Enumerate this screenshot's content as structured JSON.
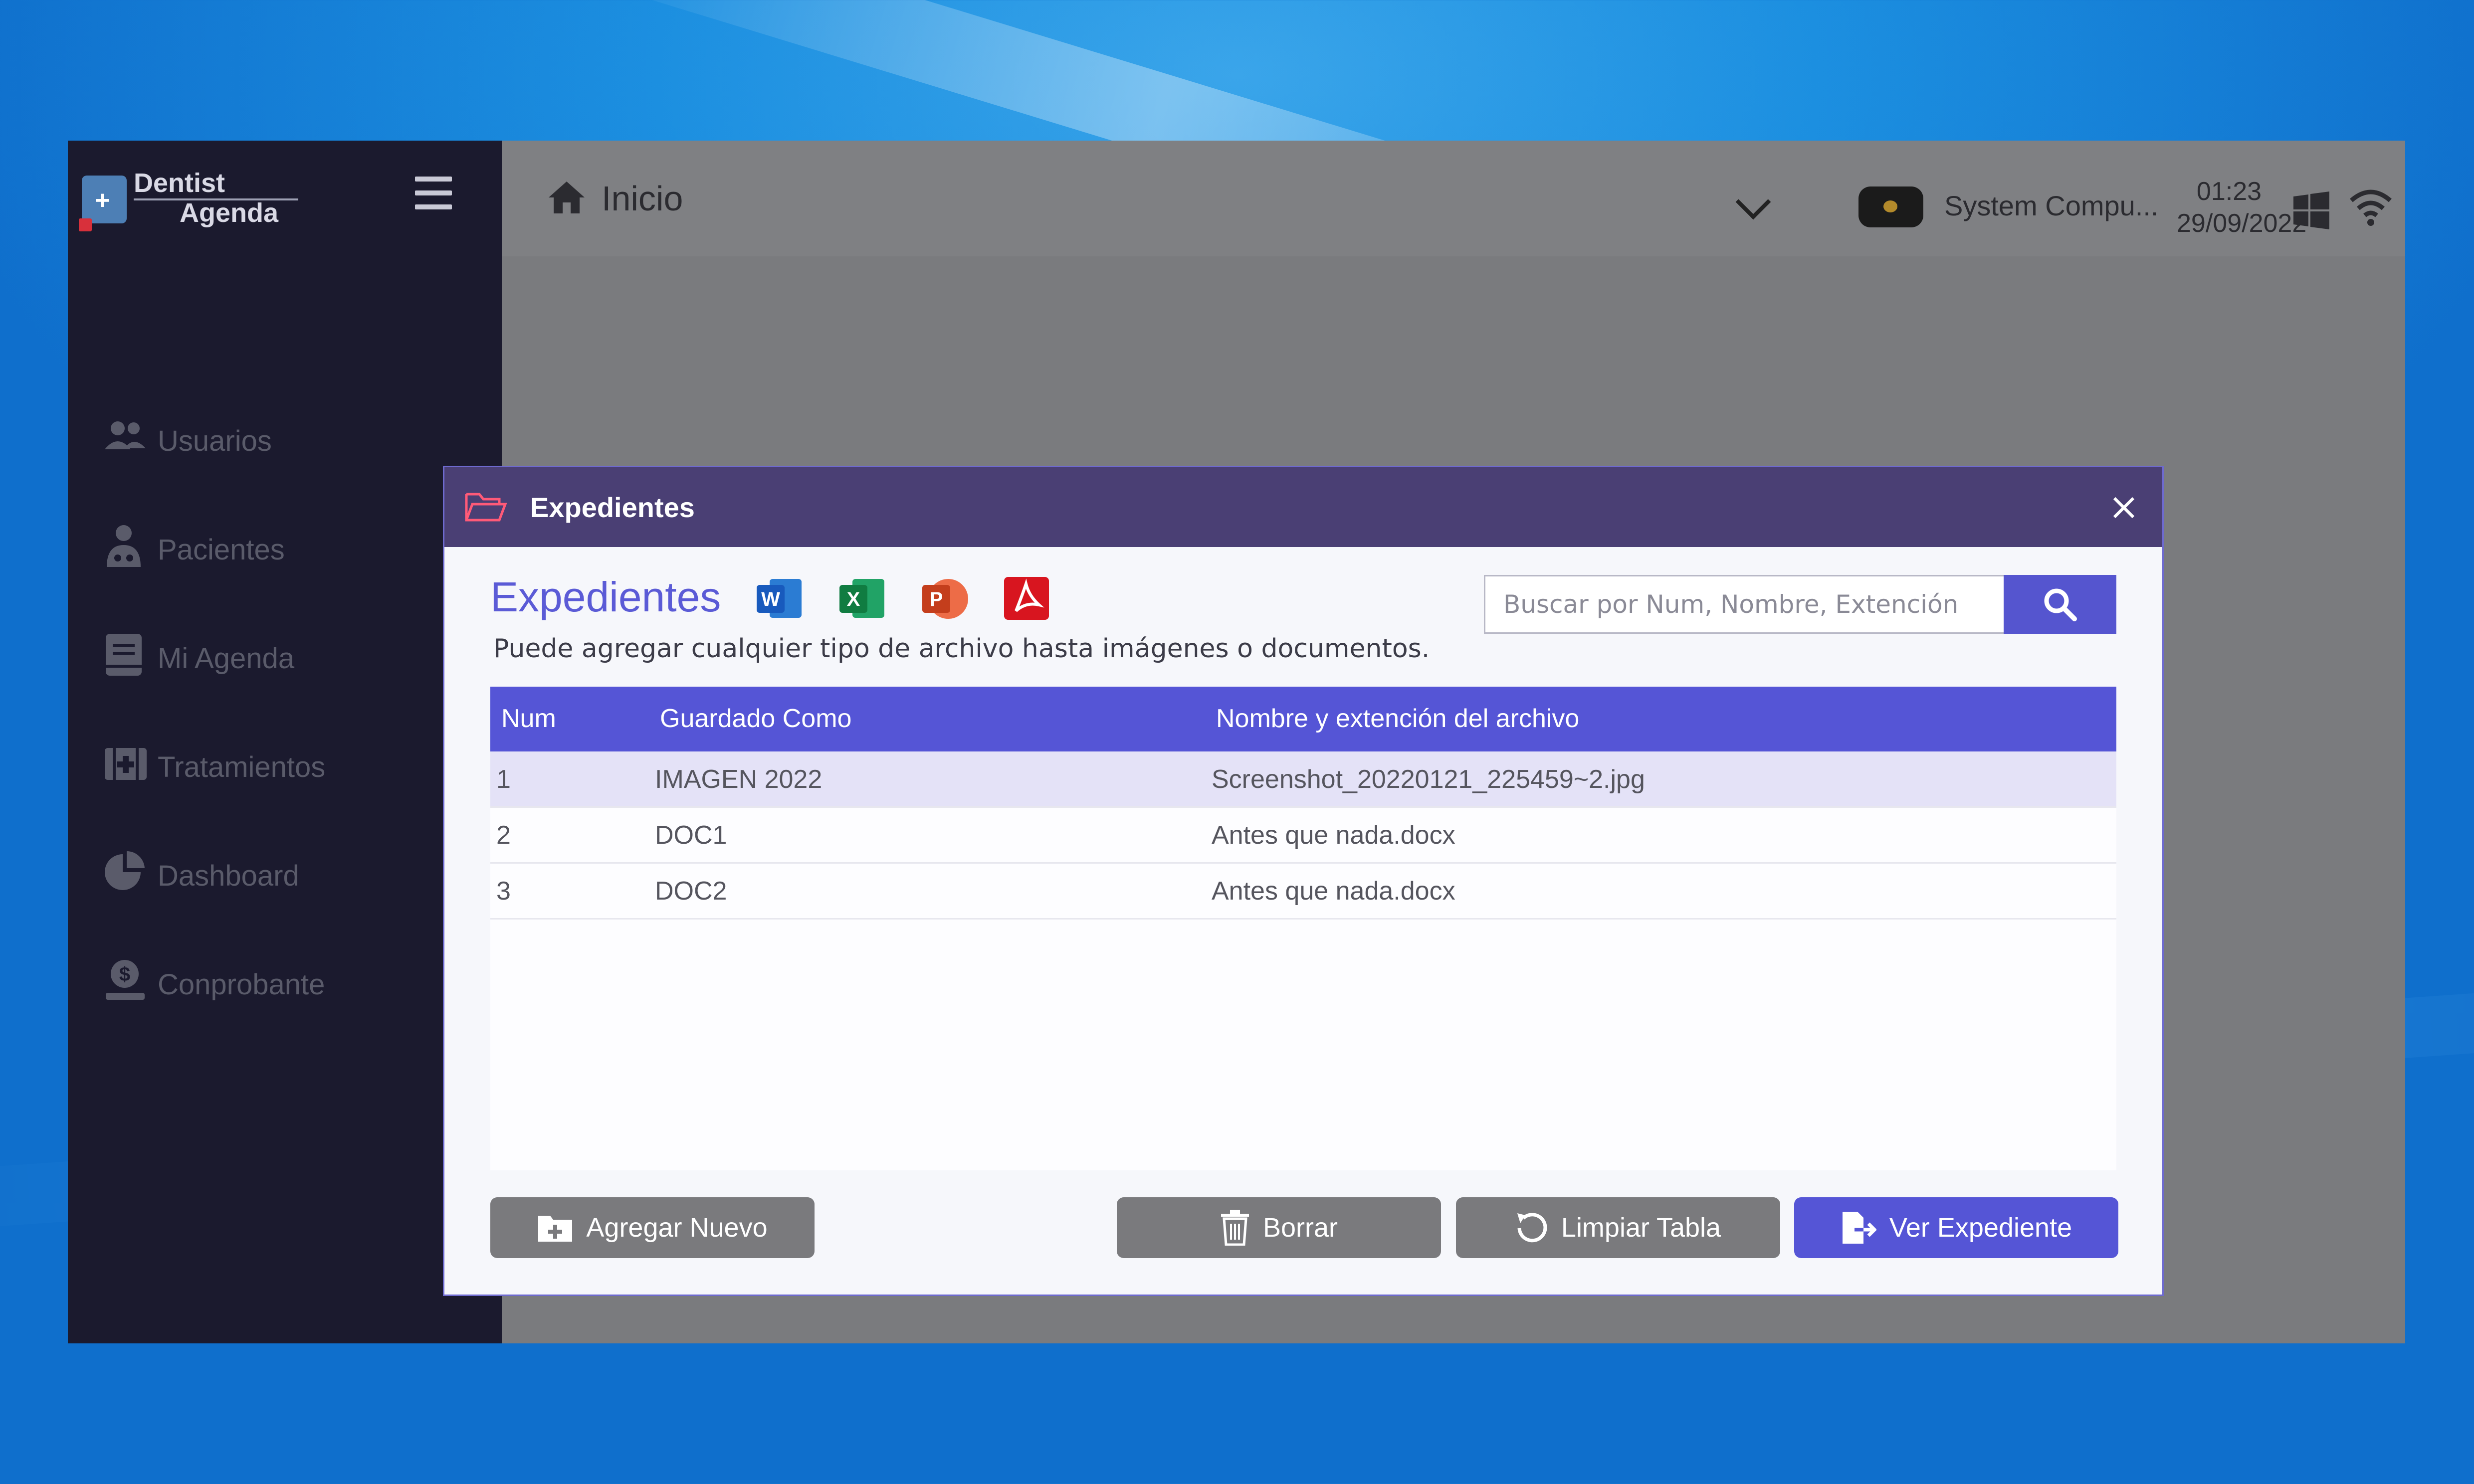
{
  "app": {
    "logo": {
      "line1": "Dentist",
      "line2": "Agenda"
    },
    "topbar": {
      "title": "Inicio",
      "system_label": "System Compu...",
      "time": "01:23",
      "date": "29/09/2022"
    },
    "sidebar": {
      "items": [
        {
          "label": "Usuarios",
          "icon": "users-icon"
        },
        {
          "label": "Pacientes",
          "icon": "doctor-icon"
        },
        {
          "label": "Mi Agenda",
          "icon": "agenda-icon"
        },
        {
          "label": "Tratamientos",
          "icon": "medical-kit-icon"
        },
        {
          "label": "Dashboard",
          "icon": "pie-chart-icon"
        },
        {
          "label": "Conprobante",
          "icon": "money-icon"
        }
      ]
    }
  },
  "dialog": {
    "header_title": "Expedientes",
    "title": "Expedientes",
    "file_types": [
      {
        "label": "W",
        "color": "#2b5fb4"
      },
      {
        "label": "X",
        "color": "#1f7b43"
      },
      {
        "label": "P",
        "color": "#d24a25"
      },
      {
        "label": "",
        "color": "#c8161d"
      }
    ],
    "subtitle": "Puede agregar cualquier tipo de archivo hasta imágenes o documentos.",
    "search_placeholder": "Buscar por Num, Nombre, Extención",
    "table": {
      "columns": [
        "Num",
        "Guardado Como",
        "Nombre y extención del archivo"
      ],
      "rows": [
        {
          "num": "1",
          "saved_as": "IMAGEN 2022",
          "filename": "Screenshot_20220121_225459~2.jpg"
        },
        {
          "num": "2",
          "saved_as": "DOC1",
          "filename": "Antes que nada.docx"
        },
        {
          "num": "3",
          "saved_as": "DOC2",
          "filename": "Antes que nada.docx"
        }
      ]
    },
    "buttons": {
      "add": "Agregar Nuevo",
      "delete": "Borrar",
      "clear": "Limpiar Tabla",
      "view": "Ver Expediente"
    }
  },
  "colors": {
    "accent": "#5555d6",
    "dialog_header": "#4a3f74",
    "sidebar_bg": "#1b1a2e",
    "selected_row": "#e4e2f7"
  }
}
